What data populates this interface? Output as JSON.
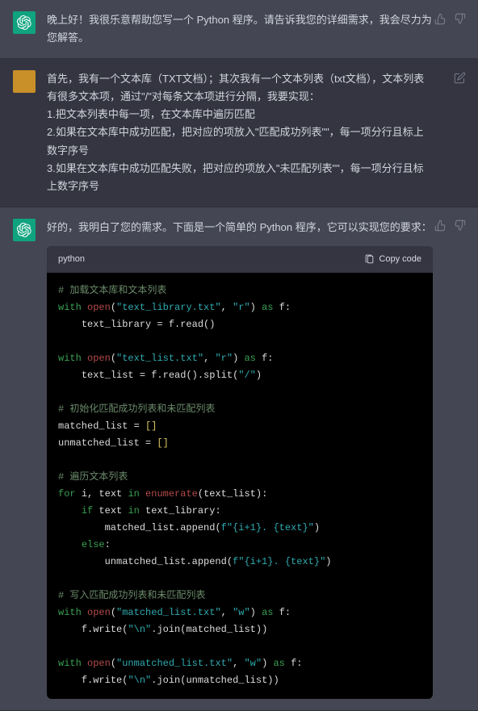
{
  "messages": [
    {
      "role": "assistant",
      "text": "晚上好！我很乐意帮助您写一个 Python 程序。请告诉我您的详细需求，我会尽力为您解答。"
    },
    {
      "role": "user",
      "text": "首先，我有一个文本库（TXT文档）；其次我有一个文本列表（txt文档），文本列表有很多文本项，通过\"/\"对每条文本项进行分隔，我要实现：\n1.把文本列表中每一项，在文本库中遍历匹配\n2.如果在文本库中成功匹配，把对应的项放入\"匹配成功列表\"\"，每一项分行且标上数字序号\n3.如果在文本库中成功匹配失败，把对应的项放入\"未匹配列表\"\"，每一项分行且标上数字序号"
    },
    {
      "role": "assistant",
      "text": "好的，我明白了您的需求。下面是一个简单的 Python 程序，它可以实现您的要求："
    }
  ],
  "code": {
    "lang": "python",
    "copy_label": "Copy code",
    "comments": {
      "c1": "# 加载文本库和文本列表",
      "c2": "# 初始化匹配成功列表和未匹配列表",
      "c3": "# 遍历文本列表",
      "c4": "# 写入匹配成功列表和未匹配列表"
    },
    "strings": {
      "s1": "\"text_library.txt\"",
      "s2": "\"r\"",
      "s3": "\"text_list.txt\"",
      "s4": "\"r\"",
      "s5": "\"/\"",
      "s6": "f\"{i+1}. {text}\"",
      "s7": "f\"{i+1}. {text}\"",
      "s8": "\"matched_list.txt\"",
      "s9": "\"w\"",
      "s10": "\"\\n\"",
      "s11": "\"unmatched_list.txt\"",
      "s12": "\"w\"",
      "s13": "\"\\n\""
    }
  },
  "icons": {
    "thumbs_up": "thumbs-up-icon",
    "thumbs_down": "thumbs-down-icon",
    "edit": "edit-icon",
    "copy": "clipboard-icon"
  }
}
